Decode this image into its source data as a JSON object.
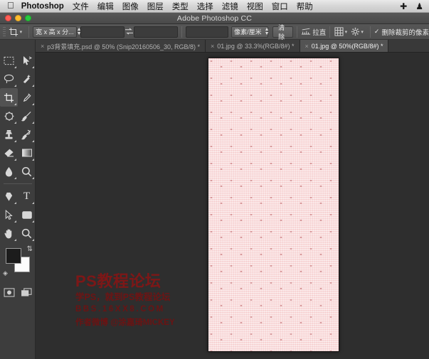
{
  "macbar": {
    "apple_icon": "apple-logo-icon",
    "app_name": "Photoshop",
    "menus": [
      "文件",
      "编辑",
      "图像",
      "图层",
      "类型",
      "选择",
      "滤镜",
      "视图",
      "窗口",
      "帮助"
    ],
    "right_icons": [
      "crosshair-icon",
      "qq-penguin-icon"
    ]
  },
  "titlebar": {
    "title": "Adobe Photoshop CC",
    "traffic_lights": [
      "close-button",
      "minimize-button",
      "zoom-button"
    ],
    "colors": {
      "close": "#ff5f57",
      "minimize": "#ffbd2e",
      "zoom": "#28c940"
    }
  },
  "options_bar": {
    "tool_icon": "crop-tool-icon",
    "preset_select": "宽 x 高 x 分...",
    "width_value": "",
    "width_placeholder": "",
    "swap_icon": "swap-arrows-icon",
    "height_value": "",
    "height_placeholder": "",
    "resolution_value": "",
    "resolution_placeholder": "",
    "unit_select": "像素/厘米",
    "clear_label": "清除",
    "straighten_icon": "straighten-icon",
    "straighten_label": "拉直",
    "overlay_icon": "grid-overlay-icon",
    "settings_icon": "gear-icon",
    "delete_cropped_checkbox": {
      "label": "删除裁剪的像素",
      "checked": true
    }
  },
  "tabs": [
    {
      "title": "p3背景填充.psd @ 50% (Snip20160506_30, RGB/8) *",
      "active": false
    },
    {
      "title": "01.jpg @ 33.3%(RGB/8#) *",
      "active": false
    },
    {
      "title": "01.jpg @ 50%(RGB/8#) *",
      "active": true
    }
  ],
  "toolbar": {
    "tools": [
      {
        "name": "rectangular-marquee-tool",
        "active": false
      },
      {
        "name": "move-tool",
        "active": false
      },
      {
        "name": "lasso-tool",
        "active": false
      },
      {
        "name": "quick-selection-tool",
        "active": false
      },
      {
        "name": "crop-tool",
        "active": true
      },
      {
        "name": "eyedropper-tool",
        "active": false
      },
      {
        "name": "spot-healing-brush-tool",
        "active": false
      },
      {
        "name": "brush-tool",
        "active": false
      },
      {
        "name": "clone-stamp-tool",
        "active": false
      },
      {
        "name": "history-brush-tool",
        "active": false
      },
      {
        "name": "eraser-tool",
        "active": false
      },
      {
        "name": "gradient-tool",
        "active": false
      },
      {
        "name": "blur-tool",
        "active": false
      },
      {
        "name": "dodge-tool",
        "active": false
      },
      {
        "name": "pen-tool",
        "active": false
      },
      {
        "name": "horizontal-type-tool",
        "active": false
      },
      {
        "name": "path-selection-tool",
        "active": false
      },
      {
        "name": "rectangle-tool",
        "active": false
      },
      {
        "name": "hand-tool",
        "active": false
      },
      {
        "name": "zoom-tool",
        "active": false
      }
    ],
    "foreground_color": "#1c1c1c",
    "background_color": "#fdfdfd",
    "swap_colors_icon": "swap-colors-icon",
    "default_colors_icon": "default-colors-icon",
    "quick_mask_icon": "quick-mask-icon",
    "screen_mode_icon": "screen-mode-icon"
  },
  "canvas": {
    "document": "01.jpg",
    "zoom": "50%",
    "base_color": "#f7d4d4",
    "pattern_color": "#d69698",
    "pattern": "pink-bow-pattern"
  },
  "watermark": {
    "line1": "PS教程论坛",
    "line2": "学PS，就到PS教程论坛",
    "line3": "BBS.16XX8.COM",
    "line4": "作者微博 @涂嘉琦MICKEY",
    "color": "#6e1414"
  }
}
